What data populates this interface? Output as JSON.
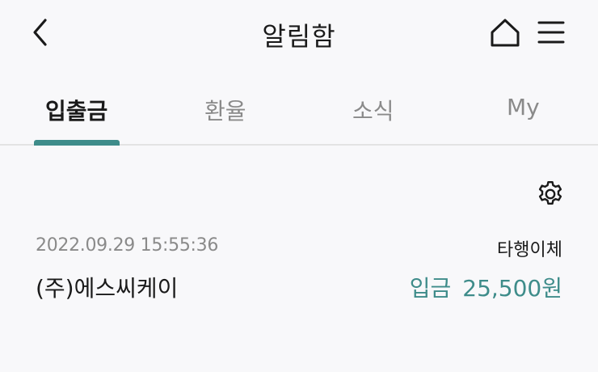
{
  "header": {
    "title": "알림함",
    "back_icon": "chevron-left-icon",
    "home_icon": "home-icon",
    "menu_icon": "hamburger-menu-icon"
  },
  "tabs": [
    {
      "label": "입출금",
      "active": true
    },
    {
      "label": "환율",
      "active": false
    },
    {
      "label": "소식",
      "active": false
    },
    {
      "label": "My",
      "active": false
    }
  ],
  "settings": {
    "icon": "gear-icon"
  },
  "notifications": [
    {
      "datetime": "2022.09.29 15:55:36",
      "type": "타행이체",
      "sender": "(주)에스씨케이",
      "direction": "입금",
      "amount": "25,500원"
    }
  ],
  "colors": {
    "accent": "#3e8c8a",
    "background": "#f8f8fa",
    "muted_text": "#8a8a8a",
    "divider": "#e3e3e3"
  }
}
